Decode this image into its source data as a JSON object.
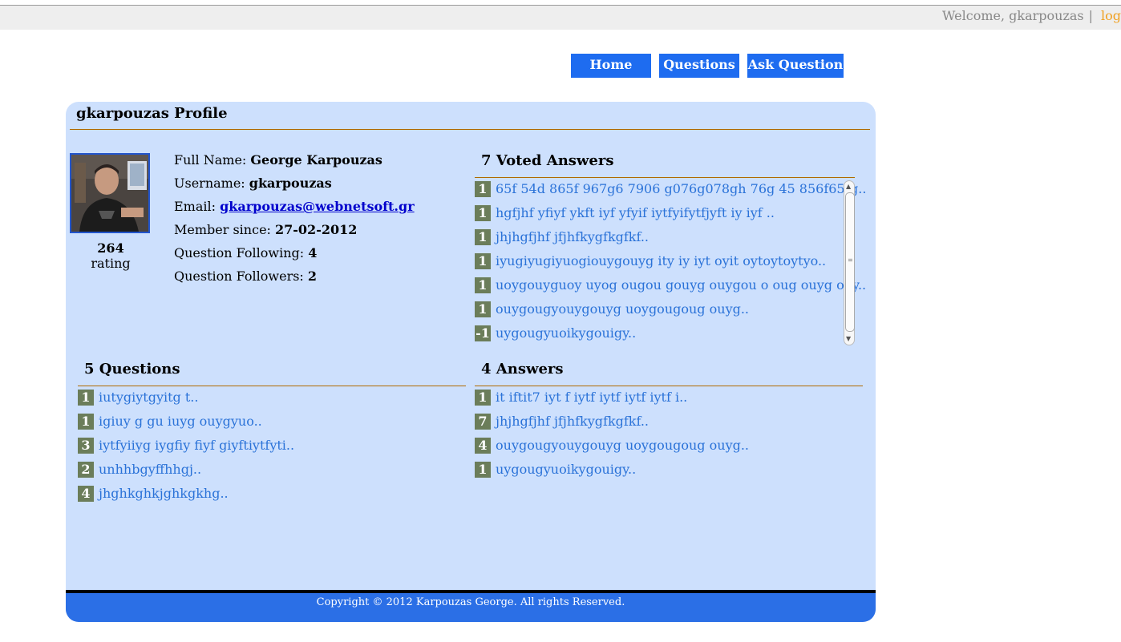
{
  "header": {
    "welcome_text": "Welcome, gkarpouzas",
    "separator": "|",
    "logout_label": "logout"
  },
  "nav": {
    "home": "Home",
    "questions": "Questions",
    "ask_question": "Ask Question"
  },
  "profile": {
    "title": "gkarpouzas Profile",
    "rating_value": "264",
    "rating_label": "rating",
    "fields": {
      "full_name_label": "Full Name:",
      "full_name": "George Karpouzas",
      "username_label": "Username:",
      "username": "gkarpouzas",
      "email_label": "Email:",
      "email": "gkarpouzas@webnetsoft.gr",
      "member_since_label": "Member since:",
      "member_since": "27-02-2012",
      "following_label": "Question Following:",
      "following": "4",
      "followers_label": "Question Followers:",
      "followers": "2"
    }
  },
  "voted_answers": {
    "title": "7 Voted Answers",
    "items": [
      {
        "score": "1",
        "text": "65f 54d 865f 967g6 7906 g076g078gh 76g 45 856f65tg.."
      },
      {
        "score": "1",
        "text": "hgfjhf yfiyf ykft iyf yfyif iytfyifytfjyft iy iyf .."
      },
      {
        "score": "1",
        "text": "jhjhgfjhf jfjhfkygfkgfkf.."
      },
      {
        "score": "1",
        "text": "iyugiyugiyuogiouygouyg ity iy iyt oyit oytoytoytyo.."
      },
      {
        "score": "1",
        "text": "uoygouyguoy uyog ougou gouyg ouygou o oug ouyg ouy.."
      },
      {
        "score": "1",
        "text": "ouygougyouygouyg uoygougoug ouyg.."
      },
      {
        "score": "-1",
        "text": "uygougyuoikygouigy.."
      }
    ]
  },
  "questions": {
    "title": "5 Questions",
    "items": [
      {
        "score": "1",
        "text": "iutygiytgyitg t.."
      },
      {
        "score": "1",
        "text": "igiuy g gu iuyg ouygyuo.."
      },
      {
        "score": "3",
        "text": "iytfyiiyg iygfiy fiyf giyftiytfyti.."
      },
      {
        "score": "2",
        "text": "unhhbgyffhhgj.."
      },
      {
        "score": "4",
        "text": "jhghkghkjghkgkhg.."
      }
    ]
  },
  "answers": {
    "title": "4 Answers",
    "items": [
      {
        "score": "1",
        "text": "it iftit7 iyt f iytf iytf iytf iytf i.."
      },
      {
        "score": "7",
        "text": "jhjhgfjhf jfjhfkygfkgfkf.."
      },
      {
        "score": "4",
        "text": "ouygougyouygouyg uoygougoug ouyg.."
      },
      {
        "score": "1",
        "text": "uygougyuoikygouigy.."
      }
    ]
  },
  "footer": {
    "copyright": "Copyright © 2012 Karpouzas George. All rights Reserved."
  }
}
